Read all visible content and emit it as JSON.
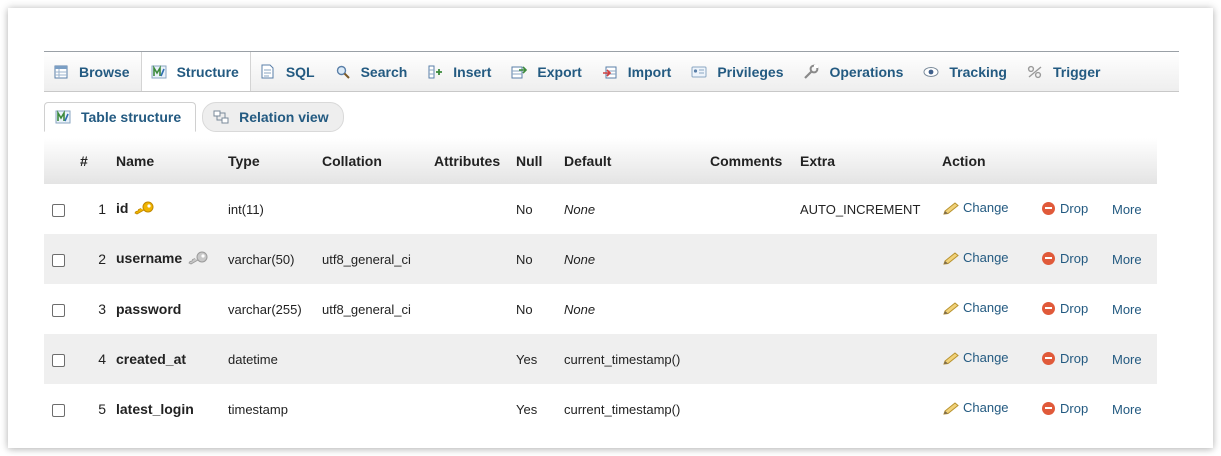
{
  "tabs": [
    {
      "label": "Browse",
      "icon": "browse-icon"
    },
    {
      "label": "Structure",
      "icon": "structure-icon",
      "active": true
    },
    {
      "label": "SQL",
      "icon": "sql-icon"
    },
    {
      "label": "Search",
      "icon": "search-icon"
    },
    {
      "label": "Insert",
      "icon": "insert-icon"
    },
    {
      "label": "Export",
      "icon": "export-icon"
    },
    {
      "label": "Import",
      "icon": "import-icon"
    },
    {
      "label": "Privileges",
      "icon": "privileges-icon"
    },
    {
      "label": "Operations",
      "icon": "operations-icon"
    },
    {
      "label": "Tracking",
      "icon": "tracking-icon"
    },
    {
      "label": "Trigger",
      "icon": "triggers-icon"
    }
  ],
  "subtabs": {
    "table_structure": "Table structure",
    "relation_view": "Relation view"
  },
  "columns": {
    "num": "#",
    "name": "Name",
    "type": "Type",
    "collation": "Collation",
    "attributes": "Attributes",
    "null": "Null",
    "default": "Default",
    "comments": "Comments",
    "extra": "Extra",
    "action": "Action"
  },
  "actions": {
    "change": "Change",
    "drop": "Drop",
    "more": "More"
  },
  "rows": [
    {
      "num": "1",
      "name": "id",
      "key": "primary",
      "type": "int(11)",
      "collation": "",
      "attributes": "",
      "null": "No",
      "default": "None",
      "comments": "",
      "extra": "AUTO_INCREMENT"
    },
    {
      "num": "2",
      "name": "username",
      "key": "unique",
      "type": "varchar(50)",
      "collation": "utf8_general_ci",
      "attributes": "",
      "null": "No",
      "default": "None",
      "comments": "",
      "extra": ""
    },
    {
      "num": "3",
      "name": "password",
      "key": "",
      "type": "varchar(255)",
      "collation": "utf8_general_ci",
      "attributes": "",
      "null": "No",
      "default": "None",
      "comments": "",
      "extra": ""
    },
    {
      "num": "4",
      "name": "created_at",
      "key": "",
      "type": "datetime",
      "collation": "",
      "attributes": "",
      "null": "Yes",
      "default": "current_timestamp()",
      "comments": "",
      "extra": ""
    },
    {
      "num": "5",
      "name": "latest_login",
      "key": "",
      "type": "timestamp",
      "collation": "",
      "attributes": "",
      "null": "Yes",
      "default": "current_timestamp()",
      "comments": "",
      "extra": ""
    }
  ],
  "colors": {
    "link": "#235a81",
    "primary_key": "#e8a400",
    "unique_key": "#a8a8a8",
    "drop": "#e05a3a",
    "row_alt": "#efefef"
  }
}
